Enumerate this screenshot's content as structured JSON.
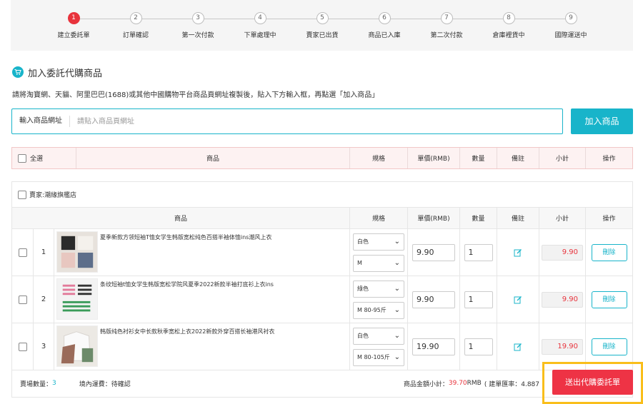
{
  "steps": [
    {
      "num": "1",
      "label": "建立委託單",
      "active": true
    },
    {
      "num": "2",
      "label": "訂單確認",
      "active": false
    },
    {
      "num": "3",
      "label": "第一次付款",
      "active": false
    },
    {
      "num": "4",
      "label": "下單處理中",
      "active": false
    },
    {
      "num": "5",
      "label": "賣家已出貨",
      "active": false
    },
    {
      "num": "6",
      "label": "商品已入庫",
      "active": false
    },
    {
      "num": "7",
      "label": "第二次付款",
      "active": false
    },
    {
      "num": "8",
      "label": "倉庫裡貨中",
      "active": false
    },
    {
      "num": "9",
      "label": "國際運送中",
      "active": false
    }
  ],
  "section": {
    "title": "加入委託代購商品",
    "instruction": "請將淘寶網、天貓、阿里巴巴(1688)或其他中國購物平台商品頁網址複製後，貼入下方輸入框，再點選「加入商品」"
  },
  "url_input": {
    "label": "輸入商品網址",
    "placeholder": "請貼入商品頁網址",
    "value": "",
    "button": "加入商品"
  },
  "table_header": {
    "select_all": "全選",
    "product": "商品",
    "spec": "規格",
    "unit_price": "單價(RMB)",
    "qty": "數量",
    "note": "備註",
    "subtotal": "小計",
    "action": "操作"
  },
  "shop": {
    "name": "賣家:潮緣旗艦店",
    "header": {
      "product": "商品",
      "spec": "規格",
      "unit_price": "單價(RMB)",
      "qty": "數量",
      "note": "備註",
      "subtotal": "小計",
      "action": "操作"
    },
    "items": [
      {
        "index": "1",
        "name": "夏季新款方领短袖T恤女学生韩版宽松纯色百搭半袖体恤ins潮风上衣",
        "spec1": "白色",
        "spec2": "M",
        "price": "9.90",
        "qty": "1",
        "subtotal": "9.90",
        "delete": "刪除"
      },
      {
        "index": "2",
        "name": "条纹短袖t恤女学生韩版宽松学院风夏季2022新款半袖打底衫上衣ins",
        "spec1": "綠色",
        "spec2": "M 80-95斤",
        "price": "9.90",
        "qty": "1",
        "subtotal": "9.90",
        "delete": "刪除"
      },
      {
        "index": "3",
        "name": "韩版纯色衬衫女中长款秋季宽松上衣2022新款外穿百搭长袖港风衬衣",
        "spec1": "白色",
        "spec2": "M 80-105斤",
        "price": "19.90",
        "qty": "1",
        "subtotal": "19.90",
        "delete": "刪除"
      }
    ]
  },
  "footer": {
    "count_label": "賣場數量：",
    "count": "3",
    "shipping_label": "境內運費：",
    "shipping_value": "待確認",
    "subtotal_label": "商品金額小計：",
    "subtotal_value": "39.70",
    "currency": " RMB",
    "rate_text": "( 建單匯率：4.887",
    "submit": "送出代購委託單"
  },
  "colors": {
    "accent": "#18b4ca",
    "red": "#e8333c",
    "highlight": "#f9be1b"
  },
  "icons": {
    "cart": "shopping-cart-icon",
    "edit": "edit-note-icon",
    "dropdown": "chevron-down-icon"
  }
}
